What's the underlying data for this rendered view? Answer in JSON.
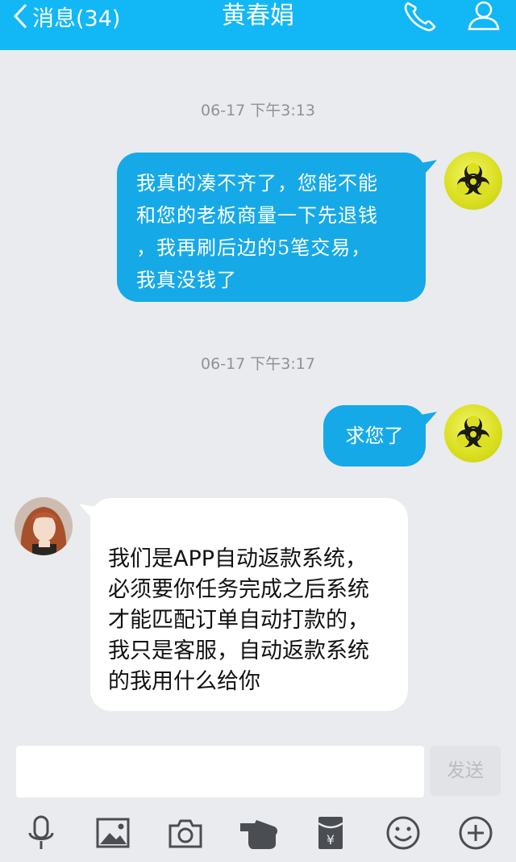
{
  "header": {
    "back_label": "消息(34)",
    "title": "黄春娟"
  },
  "messages": [
    {
      "type": "timestamp",
      "text": "06-17 下午3:13"
    },
    {
      "type": "outgoing",
      "lines": [
        "我真的凑不齐了，您能不能",
        "和您的老板商量一下先退钱",
        "，我再刷后边的5笔交易，",
        "我真没钱了"
      ]
    },
    {
      "type": "timestamp",
      "text": "06-17 下午3:17"
    },
    {
      "type": "outgoing",
      "text": "求您了"
    },
    {
      "type": "incoming",
      "lines": [
        "我们是APP自动返款系统，",
        "必须要你任务完成之后系统",
        "才能匹配订单自动打款的，",
        "我只是客服，自动返款系统",
        "的我用什么给你"
      ]
    }
  ],
  "input": {
    "value": "",
    "send_label": "发送"
  },
  "toolbar": {
    "icons": [
      "microphone-icon",
      "image-icon",
      "camera-icon",
      "hand-icon",
      "red-packet-icon",
      "emoji-icon",
      "plus-icon"
    ]
  },
  "colors": {
    "header": "#12b7f5",
    "outgoing_bubble": "#16a9e8",
    "incoming_bubble": "#ffffff",
    "background": "#e9ebef"
  }
}
